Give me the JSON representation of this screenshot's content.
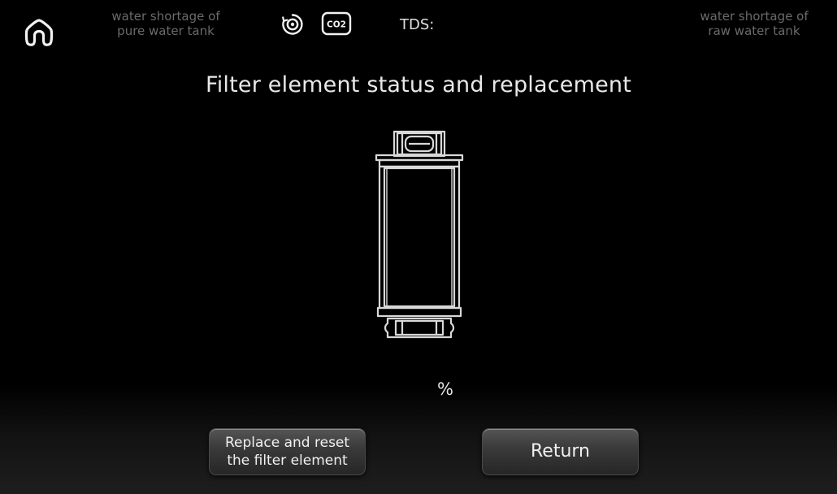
{
  "status_bar": {
    "home_icon": "home-icon",
    "pure_tank_warning": "water shortage of\npure water tank",
    "uv_icon": "uv-sterilization-icon",
    "co2_icon": "co2-icon",
    "co2_icon_text": "CO2",
    "tds_label": "TDS:",
    "raw_tank_warning": "water shortage of\nraw water tank"
  },
  "main": {
    "title": "Filter element status and replacement",
    "filter_icon": "filter-cartridge-icon",
    "percent_unit": "%"
  },
  "buttons": {
    "replace_reset_label": "Replace and reset\nthe filter element",
    "return_label": "Return"
  },
  "colors": {
    "background": "#000000",
    "text_primary": "#e8e8e8",
    "text_dim": "#6a6a6a",
    "button_top": "#555555",
    "button_bottom": "#262626"
  }
}
